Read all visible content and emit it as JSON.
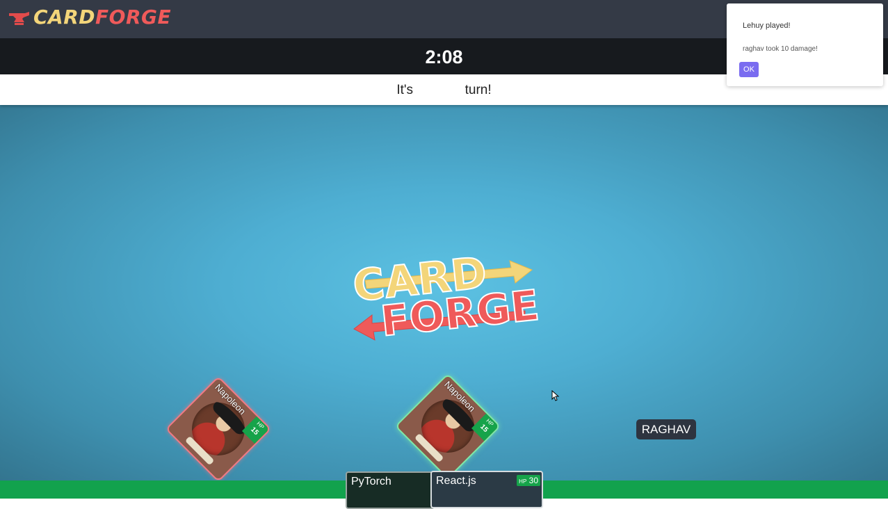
{
  "brand": {
    "part1": "CARD",
    "part2": "FORGE",
    "icon": "anvil-icon"
  },
  "timer": {
    "value": "2:08"
  },
  "turn": {
    "prefix": "It's",
    "suffix": "turn!"
  },
  "board": {
    "logo": {
      "line1": "CARD",
      "line2": "FORGE"
    },
    "cards": [
      {
        "name": "Napoleon",
        "hp_label": "HP",
        "hp": "15",
        "side": "enemy"
      },
      {
        "name": "Napoleon",
        "hp_label": "HP",
        "hp": "15",
        "side": "ally"
      }
    ],
    "player_tag": "RAGHAV"
  },
  "hand": [
    {
      "name": "PyTorch"
    },
    {
      "name": "React.js",
      "hp_label": "HP",
      "hp": "30"
    }
  ],
  "notification": {
    "title": "Lehuy played!",
    "message": "raghav took 10 damage!",
    "ok_label": "OK"
  },
  "colors": {
    "accent": "#7a6cf0",
    "brand_card": "#f3d57a",
    "brand_forge": "#ef5a5a",
    "hand_strip": "#12a24d"
  }
}
